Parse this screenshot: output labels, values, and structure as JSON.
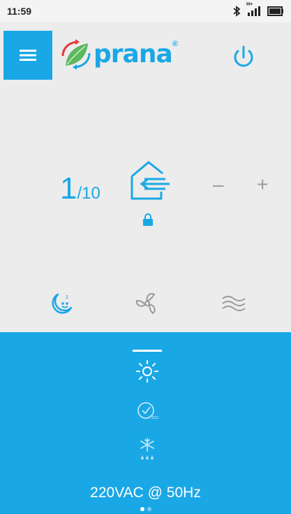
{
  "status_bar": {
    "time": "11:59",
    "network_type": "H+"
  },
  "app": {
    "logo_text": "prana",
    "logo_mark": "®"
  },
  "speed": {
    "current": "1",
    "separator_max": "/10"
  },
  "controls": {
    "minus_label": "–",
    "plus_label": "+"
  },
  "footer": {
    "voltage_text": "220VAC @ 50Hz"
  },
  "pager": {
    "current_page": 1,
    "total_pages": 2
  },
  "colors": {
    "accent": "#1aa7e6",
    "background": "#ececec",
    "inactive": "#9a9a9a"
  },
  "icons": {
    "menu": "menu-icon",
    "power": "power-icon",
    "mode": "inflow-house-icon",
    "lock": "lock-icon",
    "night": "night-mode-icon",
    "fan": "fan-icon",
    "waves": "airflow-icon",
    "sun": "sun-icon",
    "timer": "sleep-timer-icon",
    "winter": "winter-mode-icon"
  }
}
